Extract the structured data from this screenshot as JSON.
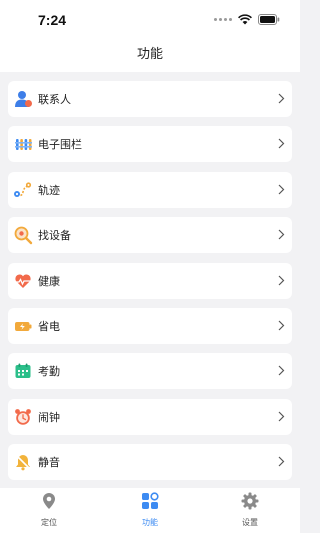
{
  "status": {
    "time": "7:24"
  },
  "nav": {
    "title": "功能"
  },
  "items": [
    {
      "label": "联系人",
      "icon": "contacts-icon"
    },
    {
      "label": "电子围栏",
      "icon": "fence-icon"
    },
    {
      "label": "轨迹",
      "icon": "route-icon"
    },
    {
      "label": "找设备",
      "icon": "find-device-icon"
    },
    {
      "label": "健康",
      "icon": "health-icon"
    },
    {
      "label": "省电",
      "icon": "battery-icon"
    },
    {
      "label": "考勤",
      "icon": "attendance-icon"
    },
    {
      "label": "闹钟",
      "icon": "alarm-icon"
    },
    {
      "label": "静音",
      "icon": "mute-bell-icon"
    }
  ],
  "tabs": [
    {
      "label": "定位",
      "icon": "location-pin-icon",
      "active": false
    },
    {
      "label": "功能",
      "icon": "grid-apps-icon",
      "active": true
    },
    {
      "label": "设置",
      "icon": "gear-icon",
      "active": false
    }
  ],
  "colors": {
    "accent": "#3d8bf2",
    "background": "#f2f2f4"
  }
}
